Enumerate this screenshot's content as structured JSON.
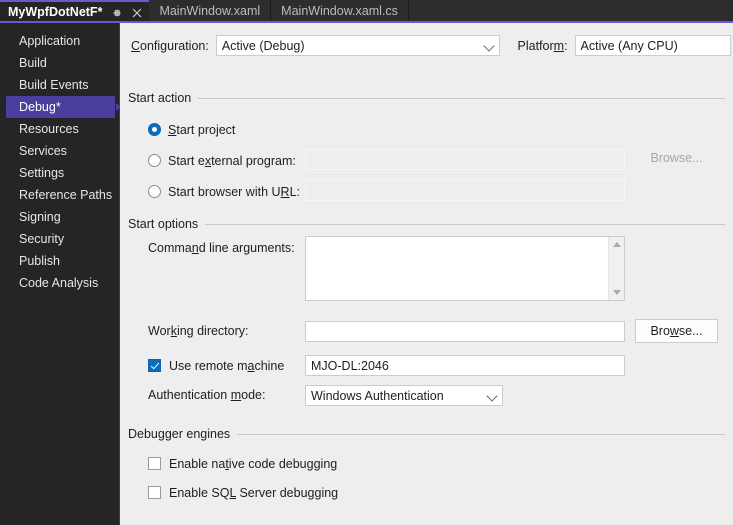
{
  "tabs": [
    {
      "label": "MyWpfDotNetF*",
      "active": true,
      "icons": [
        "pin-icon",
        "close-icon"
      ]
    },
    {
      "label": "MainWindow.xaml",
      "active": false
    },
    {
      "label": "MainWindow.xaml.cs",
      "active": false
    }
  ],
  "sidebar": {
    "items": [
      {
        "label": "Application"
      },
      {
        "label": "Build"
      },
      {
        "label": "Build Events"
      },
      {
        "label": "Debug*"
      },
      {
        "label": "Resources"
      },
      {
        "label": "Services"
      },
      {
        "label": "Settings"
      },
      {
        "label": "Reference Paths"
      },
      {
        "label": "Signing"
      },
      {
        "label": "Security"
      },
      {
        "label": "Publish"
      },
      {
        "label": "Code Analysis"
      }
    ],
    "selected_index": 3
  },
  "config_bar": {
    "configuration_label": "Configuration:",
    "configuration_value": "Active (Debug)",
    "platform_label": "Platform:",
    "platform_value": "Active (Any CPU)"
  },
  "start_action": {
    "group_title": "Start action",
    "start_project_label": "Start project",
    "start_external_label": "Start external program:",
    "start_external_value": "",
    "start_browser_label": "Start browser with URL:",
    "start_browser_value": "",
    "browse_label": "Browse...",
    "selected": "start_project"
  },
  "start_options": {
    "group_title": "Start options",
    "command_line_label": "Command line arguments:",
    "command_line_value": "",
    "working_directory_label": "Working directory:",
    "working_directory_value": "",
    "browse_label": "Browse...",
    "use_remote_machine_label": "Use remote machine",
    "use_remote_machine_checked": true,
    "remote_machine_value": "MJO-DL:2046",
    "auth_mode_label": "Authentication mode:",
    "auth_mode_value": "Windows Authentication"
  },
  "debugger_engines": {
    "group_title": "Debugger engines",
    "native_label": "Enable native code debugging",
    "native_checked": false,
    "sql_label": "Enable SQL Server debugging",
    "sql_checked": false
  },
  "colors": {
    "accent_purple": "#6b57d2",
    "sidebar_selection": "#4a3f9e",
    "control_blue": "#0a6ebd",
    "content_bg": "#eeeeee",
    "sidebar_bg": "#252526",
    "tabstrip_bg": "#2d2d30"
  }
}
